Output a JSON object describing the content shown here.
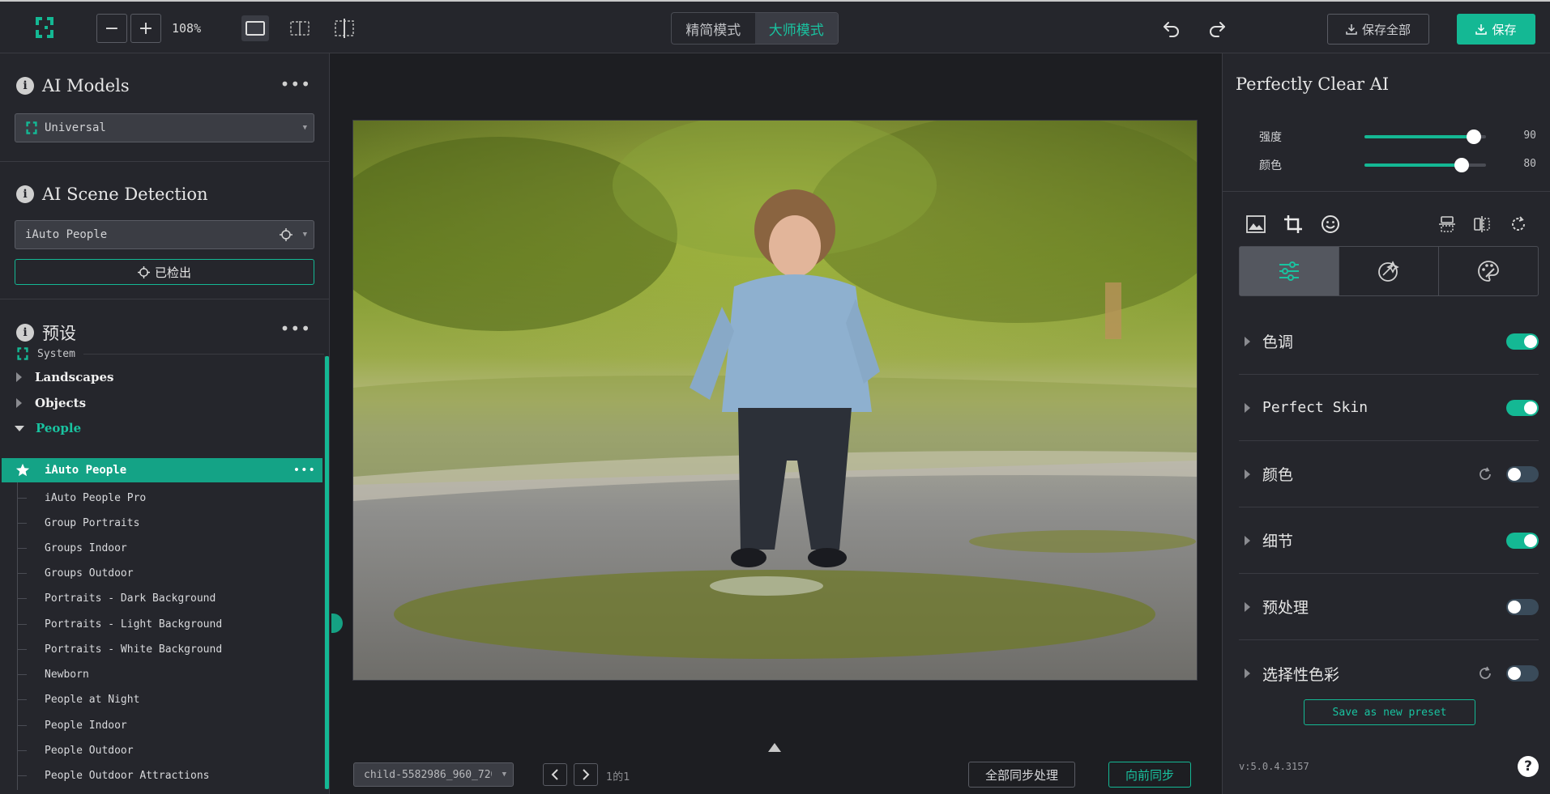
{
  "toolbar": {
    "zoom_out_label": "−",
    "zoom_in_label": "+",
    "zoom_level": "108%",
    "modes": [
      {
        "label": "精简模式",
        "active": false
      },
      {
        "label": "大师模式",
        "active": true
      }
    ],
    "save_all_label": "保存全部",
    "save_label": "保存"
  },
  "left": {
    "ai_models": {
      "title": "AI Models",
      "selected": "Universal"
    },
    "scene_detection": {
      "title": "AI Scene Detection",
      "selected": "iAuto People",
      "detected_label": "已检出"
    },
    "presets": {
      "title": "预设",
      "group_label": "System",
      "categories": [
        {
          "label": "Landscapes",
          "expanded": false
        },
        {
          "label": "Objects",
          "expanded": false
        },
        {
          "label": "People",
          "expanded": true
        }
      ],
      "selected_item": "iAuto People",
      "items": [
        "iAuto People Pro",
        "Group Portraits",
        "Groups Indoor",
        "Groups Outdoor",
        "Portraits - Dark Background",
        "Portraits - Light Background",
        "Portraits - White Background",
        "Newborn",
        "People at Night",
        "People Indoor",
        "People Outdoor",
        "People Outdoor Attractions"
      ]
    }
  },
  "center": {
    "file_name": "child-5582986_960_720",
    "page_indicator": "1的1",
    "sync_all_label": "全部同步处理",
    "sync_forward_label": "向前同步"
  },
  "right": {
    "title": "Perfectly Clear AI",
    "sliders": [
      {
        "label": "强度",
        "value": 90
      },
      {
        "label": "颜色",
        "value": 80
      }
    ],
    "adjustments": [
      {
        "label": "色调",
        "on": true,
        "reset": false
      },
      {
        "label": "Perfect Skin",
        "on": true,
        "reset": false
      },
      {
        "label": "颜色",
        "on": false,
        "reset": true
      },
      {
        "label": "细节",
        "on": true,
        "reset": false
      },
      {
        "label": "预处理",
        "on": false,
        "reset": false
      },
      {
        "label": "选择性色彩",
        "on": false,
        "reset": true
      }
    ],
    "save_preset_label": "Save as new preset",
    "version": "v:5.0.4.3157",
    "help_label": "?"
  },
  "colors": {
    "accent": "#14b894",
    "panel": "#25262c",
    "canvas": "#1d1e22"
  }
}
